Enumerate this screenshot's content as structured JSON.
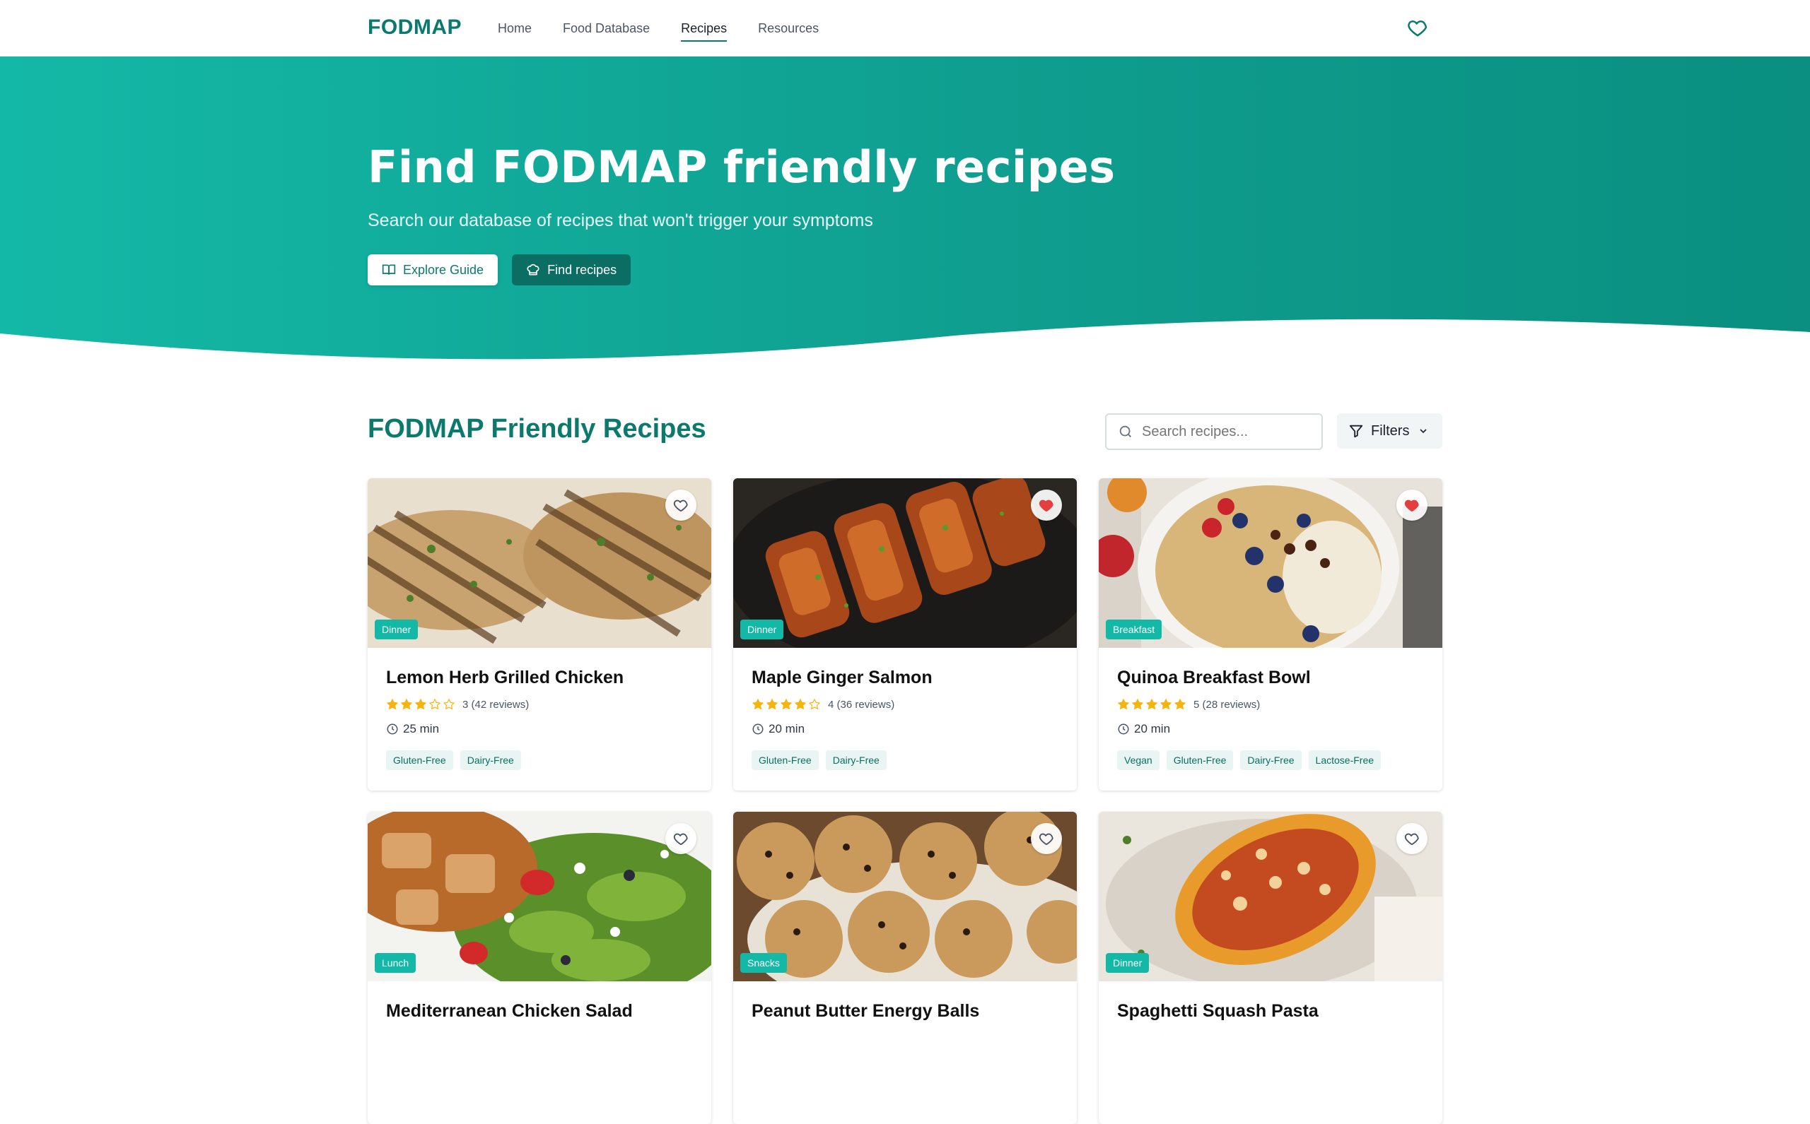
{
  "nav": {
    "brand": "FODMAP",
    "links": [
      {
        "label": "Home",
        "active": false
      },
      {
        "label": "Food Database",
        "active": false
      },
      {
        "label": "Recipes",
        "active": true
      },
      {
        "label": "Resources",
        "active": false
      }
    ],
    "favorites_icon": "heart-icon"
  },
  "hero": {
    "title": "Find FODMAP friendly recipes",
    "subtitle": "Search our database of recipes that won't trigger your symptoms",
    "explore_button": "Explore Guide",
    "find_button": "Find recipes"
  },
  "section": {
    "title": "FODMAP Friendly Recipes",
    "search_placeholder": "Search recipes...",
    "filters_label": "Filters"
  },
  "colors": {
    "brand": "#0b7a6d",
    "hero_start": "#14b8a6",
    "hero_end": "#0a8f80",
    "badge": "#14b8a6",
    "favorite_active": "#e53e3e",
    "star": "#f6b40e"
  },
  "recipes": [
    {
      "title": "Lemon Herb Grilled Chicken",
      "category": "Dinner",
      "rating": 3,
      "rating_text": "3 (42 reviews)",
      "time": "25 min",
      "tags": [
        "Gluten-Free",
        "Dairy-Free"
      ],
      "favorited": false,
      "image": "grilled-chicken-photo"
    },
    {
      "title": "Maple Ginger Salmon",
      "category": "Dinner",
      "rating": 4,
      "rating_text": "4 (36 reviews)",
      "time": "20 min",
      "tags": [
        "Gluten-Free",
        "Dairy-Free"
      ],
      "favorited": true,
      "image": "glazed-salmon-photo"
    },
    {
      "title": "Quinoa Breakfast Bowl",
      "category": "Breakfast",
      "rating": 5,
      "rating_text": "5 (28 reviews)",
      "time": "20 min",
      "tags": [
        "Vegan",
        "Gluten-Free",
        "Dairy-Free",
        "Lactose-Free"
      ],
      "favorited": true,
      "image": "quinoa-bowl-photo"
    },
    {
      "title": "Mediterranean Chicken Salad",
      "category": "Lunch",
      "favorited": false,
      "image": "chicken-salad-photo"
    },
    {
      "title": "Peanut Butter Energy Balls",
      "category": "Snacks",
      "favorited": false,
      "image": "energy-balls-photo"
    },
    {
      "title": "Spaghetti Squash Pasta",
      "category": "Dinner",
      "favorited": false,
      "image": "spaghetti-squash-photo"
    }
  ]
}
